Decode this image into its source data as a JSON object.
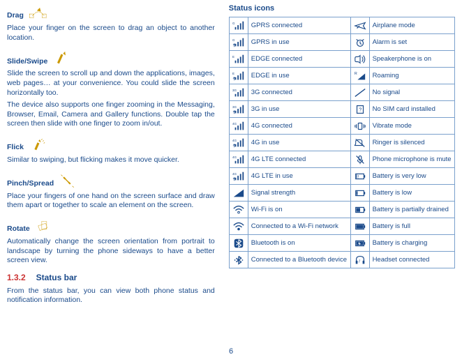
{
  "page_number": "6",
  "left": {
    "drag": {
      "title": "Drag",
      "body": "Place your finger on the screen to drag an object to another location."
    },
    "slide": {
      "title": "Slide/Swipe",
      "body1": "Slide the screen to scroll up and down the applications, images, web pages… at your convenience. You could slide the screen horizontally too.",
      "body2": "The device also supports one finger zooming in the Messaging, Browser, Email, Camera and Gallery functions. Double tap the screen then slide with one finger to zoom in/out."
    },
    "flick": {
      "title": "Flick",
      "body": "Similar to swiping, but flicking makes it move quicker."
    },
    "pinch": {
      "title": "Pinch/Spread",
      "body": "Place your fingers of one hand on the screen surface and draw them apart or together to scale an element on the screen."
    },
    "rotate": {
      "title": "Rotate",
      "body": "Automatically change the screen orientation from portrait to landscape by turning the phone sideways to have a better screen view."
    },
    "section": {
      "num": "1.3.2",
      "title": "Status bar",
      "body": "From the status bar, you can view both phone status and notification information."
    }
  },
  "right": {
    "heading": "Status icons",
    "rows": [
      {
        "l": "GPRS connected",
        "r": "Airplane mode"
      },
      {
        "l": "GPRS in use",
        "r": "Alarm is set"
      },
      {
        "l": "EDGE connected",
        "r": "Speakerphone is on"
      },
      {
        "l": "EDGE in use",
        "r": "Roaming"
      },
      {
        "l": "3G connected",
        "r": "No signal"
      },
      {
        "l": "3G in use",
        "r": "No SIM card installed"
      },
      {
        "l": "4G connected",
        "r": "Vibrate mode"
      },
      {
        "l": "4G in use",
        "r": "Ringer is silenced"
      },
      {
        "l": "4G LTE connected",
        "r": "Phone microphone is mute"
      },
      {
        "l": "4G LTE in use",
        "r": "Battery is very low"
      },
      {
        "l": "Signal strength",
        "r": "Battery is low"
      },
      {
        "l": "Wi-Fi is on",
        "r": "Battery is partially drained"
      },
      {
        "l": "Connected to a Wi-Fi network",
        "r": "Battery is full"
      },
      {
        "l": "Bluetooth is on",
        "r": "Battery is charging"
      },
      {
        "l": "Connected to a Bluetooth device",
        "r": "Headset connected"
      }
    ]
  }
}
